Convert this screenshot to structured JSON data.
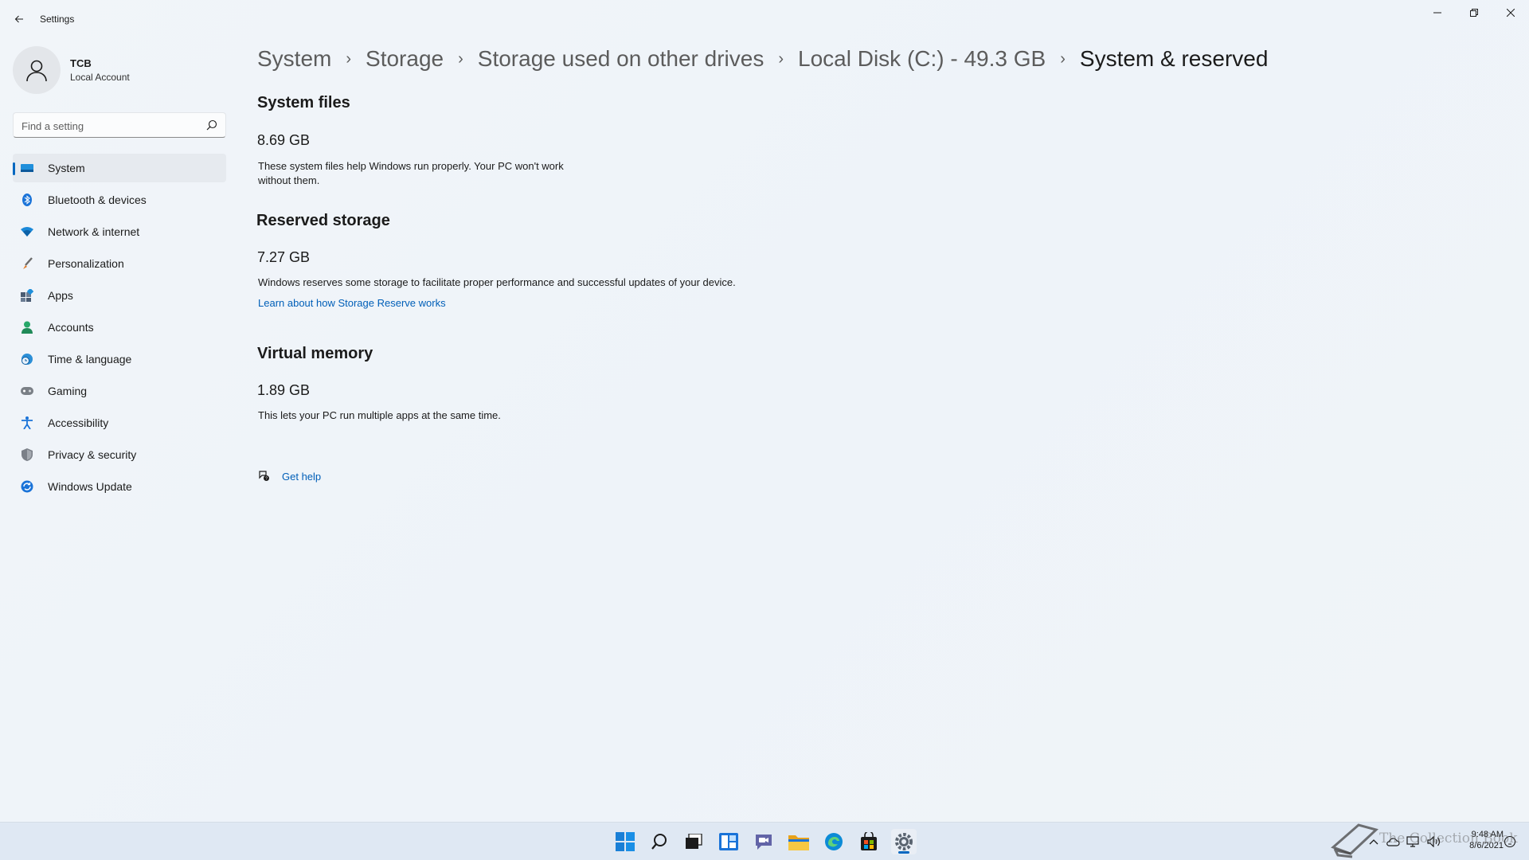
{
  "app": {
    "title": "Settings"
  },
  "profile": {
    "name": "TCB",
    "account_type": "Local Account"
  },
  "search": {
    "placeholder": "Find a setting"
  },
  "sidebar": {
    "items": [
      {
        "label": "System",
        "icon": "system-icon",
        "selected": true
      },
      {
        "label": "Bluetooth & devices",
        "icon": "bluetooth-icon"
      },
      {
        "label": "Network & internet",
        "icon": "wifi-icon"
      },
      {
        "label": "Personalization",
        "icon": "brush-icon"
      },
      {
        "label": "Apps",
        "icon": "apps-icon"
      },
      {
        "label": "Accounts",
        "icon": "person-icon"
      },
      {
        "label": "Time & language",
        "icon": "globe-clock-icon"
      },
      {
        "label": "Gaming",
        "icon": "gamepad-icon"
      },
      {
        "label": "Accessibility",
        "icon": "accessibility-icon"
      },
      {
        "label": "Privacy & security",
        "icon": "shield-icon"
      },
      {
        "label": "Windows Update",
        "icon": "update-icon"
      }
    ]
  },
  "breadcrumb": [
    "System",
    "Storage",
    "Storage used on other drives",
    "Local Disk (C:) - 49.3 GB",
    "System & reserved"
  ],
  "sections": {
    "system_files": {
      "title": "System files",
      "size": "8.69 GB",
      "description_line1": "These system files help Windows run properly. Your PC won't work",
      "description_line2": "without them."
    },
    "reserved_storage": {
      "title": "Reserved storage",
      "size": "7.27 GB",
      "description": "Windows reserves some storage to facilitate proper performance and successful updates of your device.",
      "link": "Learn about how Storage Reserve works"
    },
    "virtual_memory": {
      "title": "Virtual memory",
      "size": "1.89 GB",
      "description": "This lets your PC run multiple apps at the same time."
    }
  },
  "help": {
    "label": "Get help"
  },
  "taskbar": {
    "apps": [
      "start-icon",
      "search-icon",
      "task-view-icon",
      "widgets-icon",
      "chat-icon",
      "file-explorer-icon",
      "edge-icon",
      "store-icon",
      "settings-icon"
    ],
    "active_app": "settings-icon",
    "time": "9:48 AM",
    "date": "8/6/2021"
  },
  "watermark": {
    "text": "The Collection Book"
  },
  "colors": {
    "accent": "#0067c0",
    "link": "#005fb8"
  }
}
